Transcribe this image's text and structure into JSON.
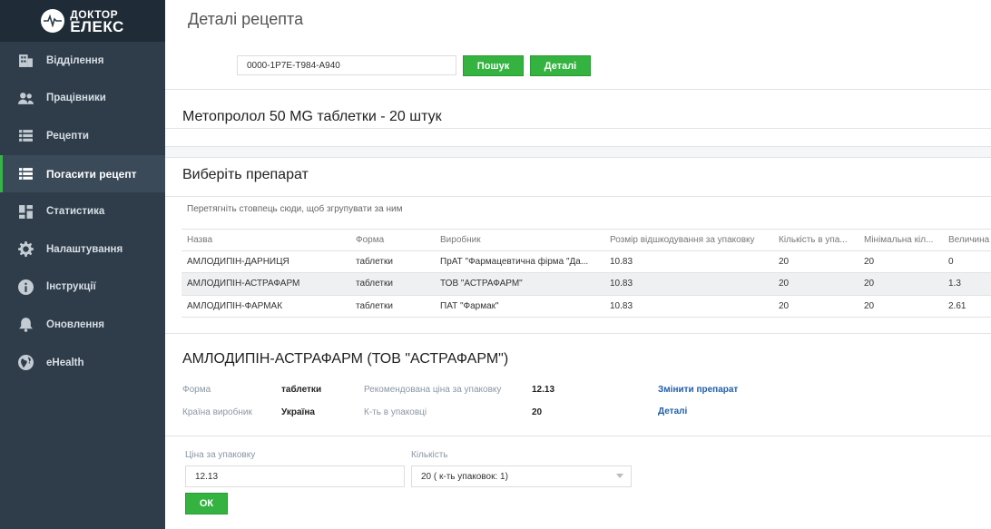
{
  "brand": {
    "line1": "ДОКТОР",
    "line2": "ЕЛЕКС"
  },
  "sidebar": {
    "items": [
      {
        "label": "Відділення",
        "icon": "building-icon"
      },
      {
        "label": "Працівники",
        "icon": "people-icon"
      },
      {
        "label": "Рецепти",
        "icon": "list-icon"
      },
      {
        "label": "Погасити рецепт",
        "icon": "list-icon",
        "active": true
      },
      {
        "label": "Статистика",
        "icon": "dashboard-icon"
      },
      {
        "label": "Налаштування",
        "icon": "gear-icon"
      },
      {
        "label": "Інструкції",
        "icon": "info-icon"
      },
      {
        "label": "Оновлення",
        "icon": "bell-icon"
      },
      {
        "label": "eHealth",
        "icon": "globe-icon"
      }
    ]
  },
  "page": {
    "title": "Деталі рецепта"
  },
  "search": {
    "value": "0000-1P7E-T984-A940",
    "search_label": "Пошук",
    "details_label": "Деталі"
  },
  "prescription": {
    "drug": "Метопролол 50 MG таблетки - 20 штук"
  },
  "select": {
    "title": "Виберіть препарат",
    "group_hint": "Перетягніть стовпець сюди, щоб згрупувати за ним",
    "columns": [
      "Назва",
      "Форма",
      "Виробник",
      "Розмір відшкодування за упаковку",
      "Кількість в упа...",
      "Мінімальна кіл...",
      "Величина"
    ],
    "rows": [
      [
        "АМЛОДИПІН-ДАРНИЦЯ",
        "таблетки",
        "ПрАТ \"Фармацевтична фірма \"Да...",
        "10.83",
        "20",
        "20",
        "0"
      ],
      [
        "АМЛОДИПІН-АСТРАФАРМ",
        "таблетки",
        "ТОВ \"АСТРАФАРМ\"",
        "10.83",
        "20",
        "20",
        "1.3"
      ],
      [
        "АМЛОДИПІН-ФАРМАК",
        "таблетки",
        "ПАТ \"Фармак\"",
        "10.83",
        "20",
        "20",
        "2.61"
      ]
    ]
  },
  "selected": {
    "title": "АМЛОДИПІН-АСТРАФАРМ (ТОВ \"АСТРАФАРМ\")",
    "form_label": "Форма",
    "form_value": "таблетки",
    "country_label": "Країна виробник",
    "country_value": "Україна",
    "price_label": "Рекомендована ціна за упаковку",
    "price_value": "12.13",
    "qty_label": "К-ть в упаковці",
    "qty_value": "20",
    "change_link": "Змінити препарат",
    "details_link": "Деталі"
  },
  "order": {
    "price_label": "Ціна за упаковку",
    "price_value": "12.13",
    "qty_label": "Кількість",
    "qty_value": "20 ( к-ть упаковок: 1)",
    "ok_label": "ОК"
  },
  "colors": {
    "sidebar": "#2f3d4a",
    "accent": "#34b341",
    "link": "#1f5fa8"
  }
}
